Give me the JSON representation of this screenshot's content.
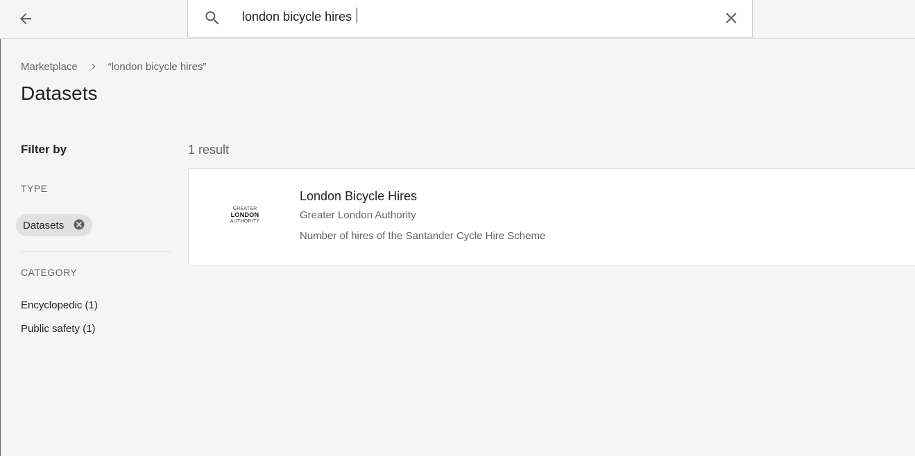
{
  "search": {
    "query": "london bicycle hires"
  },
  "breadcrumb": {
    "root": "Marketplace",
    "current": "“london bicycle hires”"
  },
  "page_title": "Datasets",
  "filters": {
    "title": "Filter by",
    "type_label": "TYPE",
    "type_chip": "Datasets",
    "category_label": "CATEGORY",
    "categories": [
      "Encyclopedic (1)",
      "Public safety (1)"
    ]
  },
  "results": {
    "count_label": "1 result",
    "items": [
      {
        "title": "London Bicycle Hires",
        "publisher": "Greater London Authority",
        "description": "Number of hires of the Santander Cycle Hire Scheme",
        "logo_lines": [
          "GREATER",
          "LONDON",
          "AUTHORITY"
        ]
      }
    ]
  },
  "icons": {
    "back": "arrow-back-icon",
    "search": "search-icon",
    "clear": "close-icon",
    "chip_remove": "cancel-circle-icon",
    "breadcrumb_separator": "chevron-right-icon"
  },
  "colors": {
    "background": "#f5f5f5",
    "card": "#ffffff",
    "chip": "#e0e0e0",
    "text_primary": "#202124",
    "text_secondary": "#5f6368"
  }
}
